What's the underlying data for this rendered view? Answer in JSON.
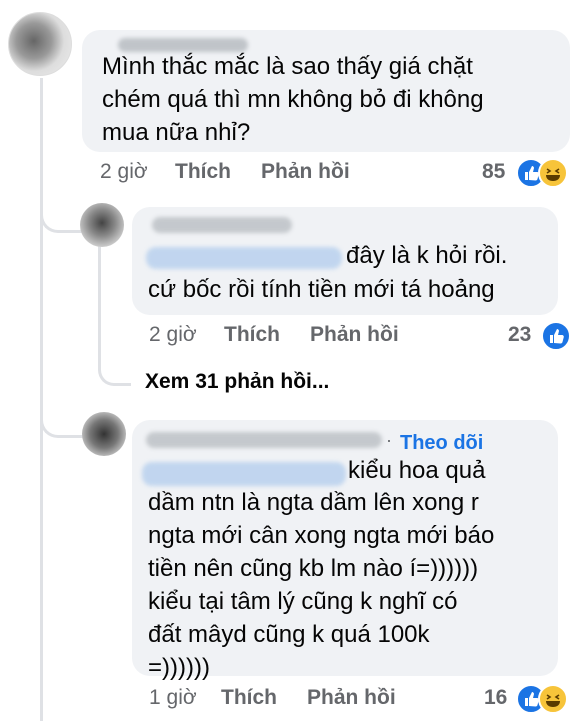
{
  "comments": [
    {
      "text_lines": [
        "Mình thắc mắc là sao thấy giá chặt",
        "chém quá thì mn không bỏ đi không",
        "mua nữa nhỉ?"
      ],
      "time": "2 giờ",
      "like": "Thích",
      "reply": "Phản hồi",
      "reaction_count": "85",
      "reactions": [
        "like-icon",
        "haha-icon"
      ]
    },
    {
      "text_lines": [
        "đây là k hỏi rồi.",
        "cứ bốc rồi tính tiền mới tá hoảng"
      ],
      "time": "2 giờ",
      "like": "Thích",
      "reply": "Phản hồi",
      "reaction_count": "23",
      "reactions": [
        "like-icon"
      ]
    },
    {
      "follow": "Theo dõi",
      "text_lines": [
        "kiểu hoa quả",
        "dầm ntn là ngta dầm lên xong r",
        "ngta mới cân xong ngta mới báo",
        "tiền nên cũng kb lm nào í=))))))",
        "kiểu tại tâm lý cũng k nghĩ có",
        "đất mâyd cũng k quá 100k",
        "=))))))"
      ],
      "time": "1 giờ",
      "like": "Thích",
      "reply": "Phản hồi",
      "reaction_count": "16",
      "reactions": [
        "like-icon",
        "haha-icon"
      ]
    }
  ],
  "view_more": "Xem 31 phản hồi...",
  "colors": {
    "bubble": "#f0f2f5",
    "meta": "#65676b",
    "link": "#1b74e4",
    "like": "#1b74e4",
    "haha": "#f7c43a"
  }
}
